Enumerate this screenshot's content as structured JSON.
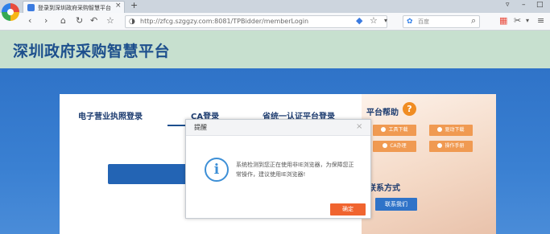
{
  "browser": {
    "tab_title": "登录到深圳政府采购智慧平台",
    "tab_close": "×",
    "new_tab": "+",
    "url": "http://zfcg.szggzy.com:8081/TPBidder/memberLogin",
    "search_placeholder": "百度",
    "window_controls": [
      "▿",
      "–",
      "□"
    ]
  },
  "header": {
    "title": "深圳政府采购智慧平台"
  },
  "login": {
    "tabs": [
      "电子营业执照登录",
      "CA登录",
      "省统一认证平台登录"
    ]
  },
  "help": {
    "title": "平台帮助",
    "qmark": "?",
    "buttons": [
      "工具下载",
      "驱动下载",
      "CA办理",
      "操作手册"
    ],
    "contact_title": "联系方式",
    "contact_button": "联系我们"
  },
  "modal": {
    "title": "提醒",
    "close": "×",
    "icon_glyph": "i",
    "message": "系统检测到您正在使用非IE浏览器，为保障您正常操作，建议使用IE浏览器!",
    "ok": "确定"
  }
}
